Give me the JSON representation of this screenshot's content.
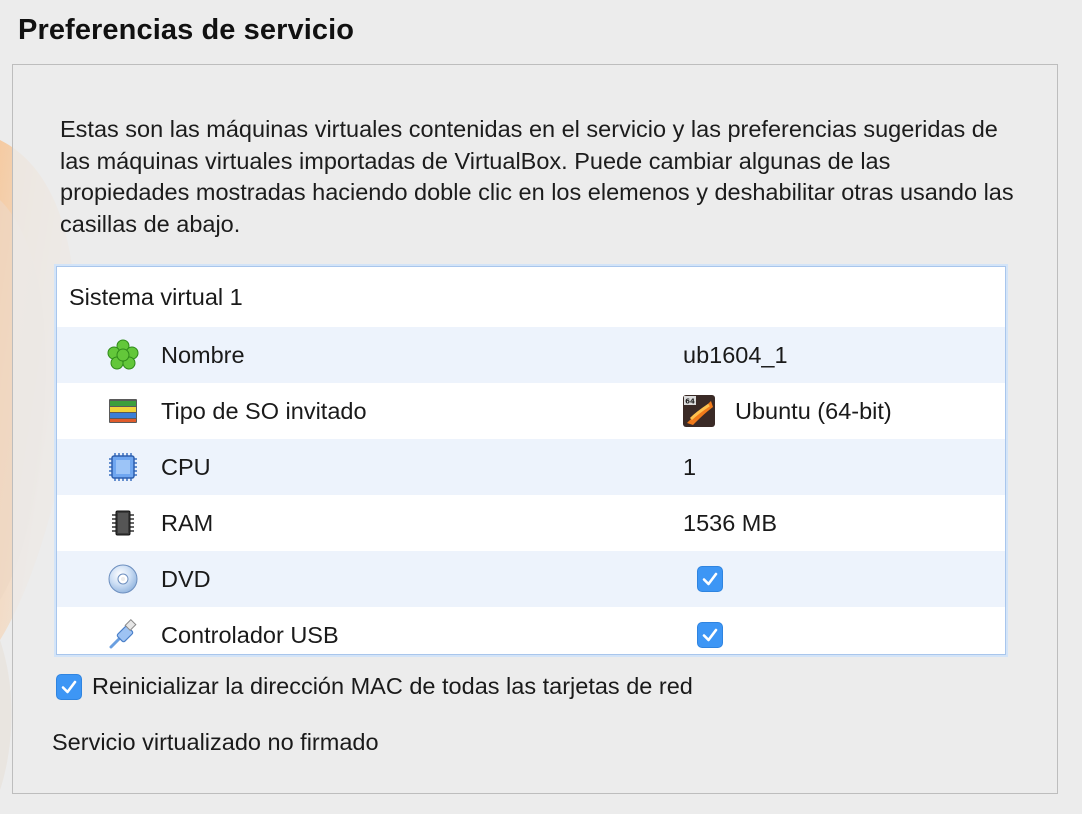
{
  "window": {
    "title": "Preferencias de servicio"
  },
  "description": "Estas son las máquinas virtuales contenidas en el servicio y las preferencias sugeridas de las máquinas virtuales importadas de VirtualBox. Puede cambiar algunas de las propiedades mostradas haciendo doble clic en los elemenos y deshabilitar otras usando las casillas de abajo.",
  "appliance": {
    "system_label": "Sistema virtual 1",
    "rows": [
      {
        "icon": "name-icon",
        "label": "Nombre",
        "value": "ub1604_1"
      },
      {
        "icon": "os-type-icon",
        "label": "Tipo de SO invitado",
        "value": "Ubuntu (64-bit)",
        "badge_icon": "ubuntu-64-icon"
      },
      {
        "icon": "cpu-icon",
        "label": "CPU",
        "value": "1"
      },
      {
        "icon": "ram-icon",
        "label": "RAM",
        "value": "1536 MB"
      },
      {
        "icon": "dvd-icon",
        "label": "DVD",
        "checked": true
      },
      {
        "icon": "usb-icon",
        "label": "Controlador USB",
        "checked": true
      }
    ]
  },
  "options": {
    "reset_mac_label": "Reinicializar la dirección MAC de todas las tarjetas de red",
    "reset_mac_checked": true
  },
  "signature_status": "Servicio virtualizado no firmado",
  "colors": {
    "accent": "#3d96f5",
    "row_alt": "#edf3fc",
    "list_border": "#a9c6ec"
  }
}
